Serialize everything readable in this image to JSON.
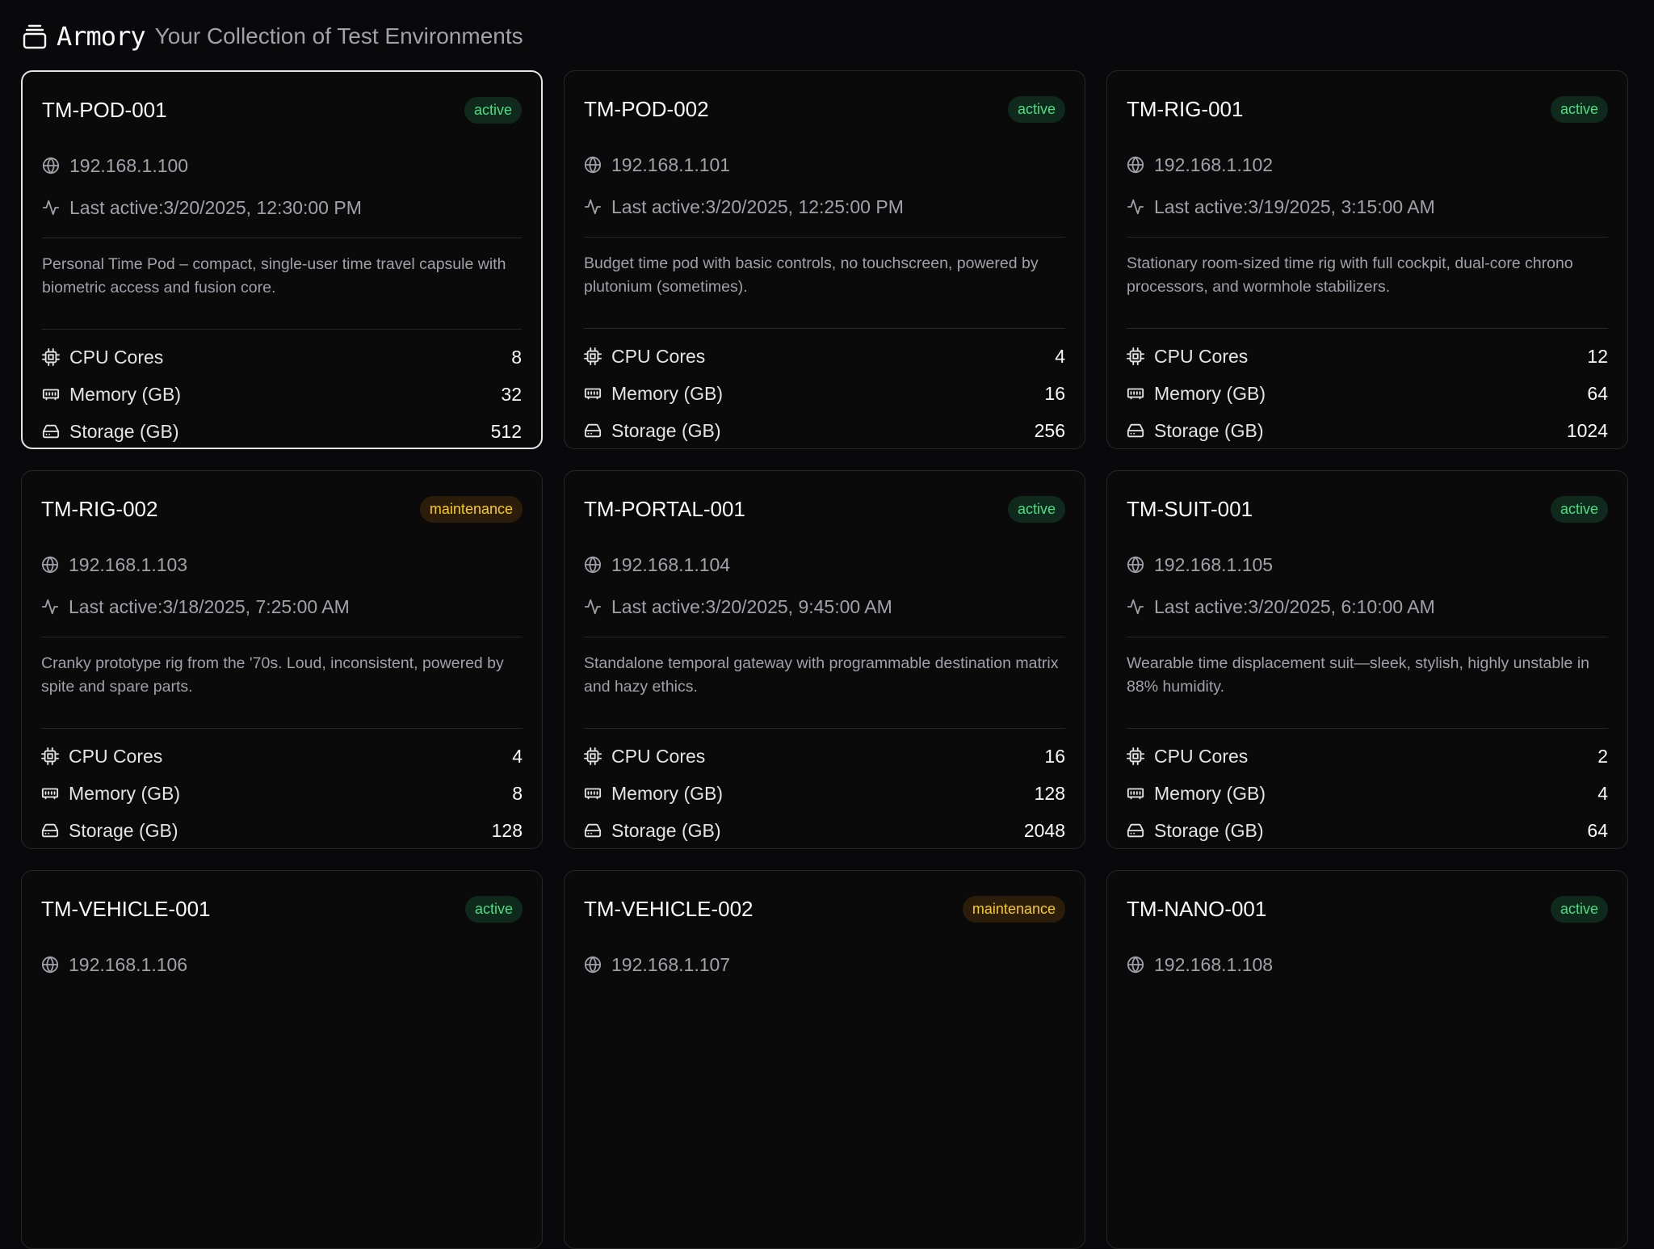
{
  "header": {
    "brand": "Armory",
    "subtitle": "Your Collection of Test Environments"
  },
  "labels": {
    "last_active_prefix": "Last active: ",
    "cpu": "CPU Cores",
    "memory": "Memory (GB)",
    "storage": "Storage (GB)"
  },
  "colors": {
    "background": "#09090b",
    "active_badge_bg": "#0f2a1d",
    "active_badge_fg": "#4ade80",
    "maintenance_badge_bg": "#2b1d0a",
    "maintenance_badge_fg": "#facc15"
  },
  "environments": [
    {
      "name": "TM-POD-001",
      "status": "active",
      "ip": "192.168.1.100",
      "last_active": "3/20/2025, 12:30:00 PM",
      "description": "Personal Time Pod – compact, single-user time travel capsule with biometric access and fusion core.",
      "cpu": "8",
      "memory": "32",
      "storage": "512",
      "selected": true
    },
    {
      "name": "TM-POD-002",
      "status": "active",
      "ip": "192.168.1.101",
      "last_active": "3/20/2025, 12:25:00 PM",
      "description": "Budget time pod with basic controls, no touchscreen, powered by plutonium (sometimes).",
      "cpu": "4",
      "memory": "16",
      "storage": "256"
    },
    {
      "name": "TM-RIG-001",
      "status": "active",
      "ip": "192.168.1.102",
      "last_active": "3/19/2025, 3:15:00 AM",
      "description": "Stationary room-sized time rig with full cockpit, dual-core chrono processors, and wormhole stabilizers.",
      "cpu": "12",
      "memory": "64",
      "storage": "1024"
    },
    {
      "name": "TM-RIG-002",
      "status": "maintenance",
      "ip": "192.168.1.103",
      "last_active": "3/18/2025, 7:25:00 AM",
      "description": "Cranky prototype rig from the '70s. Loud, inconsistent, powered by spite and spare parts.",
      "cpu": "4",
      "memory": "8",
      "storage": "128"
    },
    {
      "name": "TM-PORTAL-001",
      "status": "active",
      "ip": "192.168.1.104",
      "last_active": "3/20/2025, 9:45:00 AM",
      "description": "Standalone temporal gateway with programmable destination matrix and hazy ethics.",
      "cpu": "16",
      "memory": "128",
      "storage": "2048"
    },
    {
      "name": "TM-SUIT-001",
      "status": "active",
      "ip": "192.168.1.105",
      "last_active": "3/20/2025, 6:10:00 AM",
      "description": "Wearable time displacement suit—sleek, stylish, highly unstable in 88% humidity.",
      "cpu": "2",
      "memory": "4",
      "storage": "64"
    },
    {
      "name": "TM-VEHICLE-001",
      "status": "active",
      "ip": "192.168.1.106"
    },
    {
      "name": "TM-VEHICLE-002",
      "status": "maintenance",
      "ip": "192.168.1.107"
    },
    {
      "name": "TM-NANO-001",
      "status": "active",
      "ip": "192.168.1.108"
    }
  ]
}
